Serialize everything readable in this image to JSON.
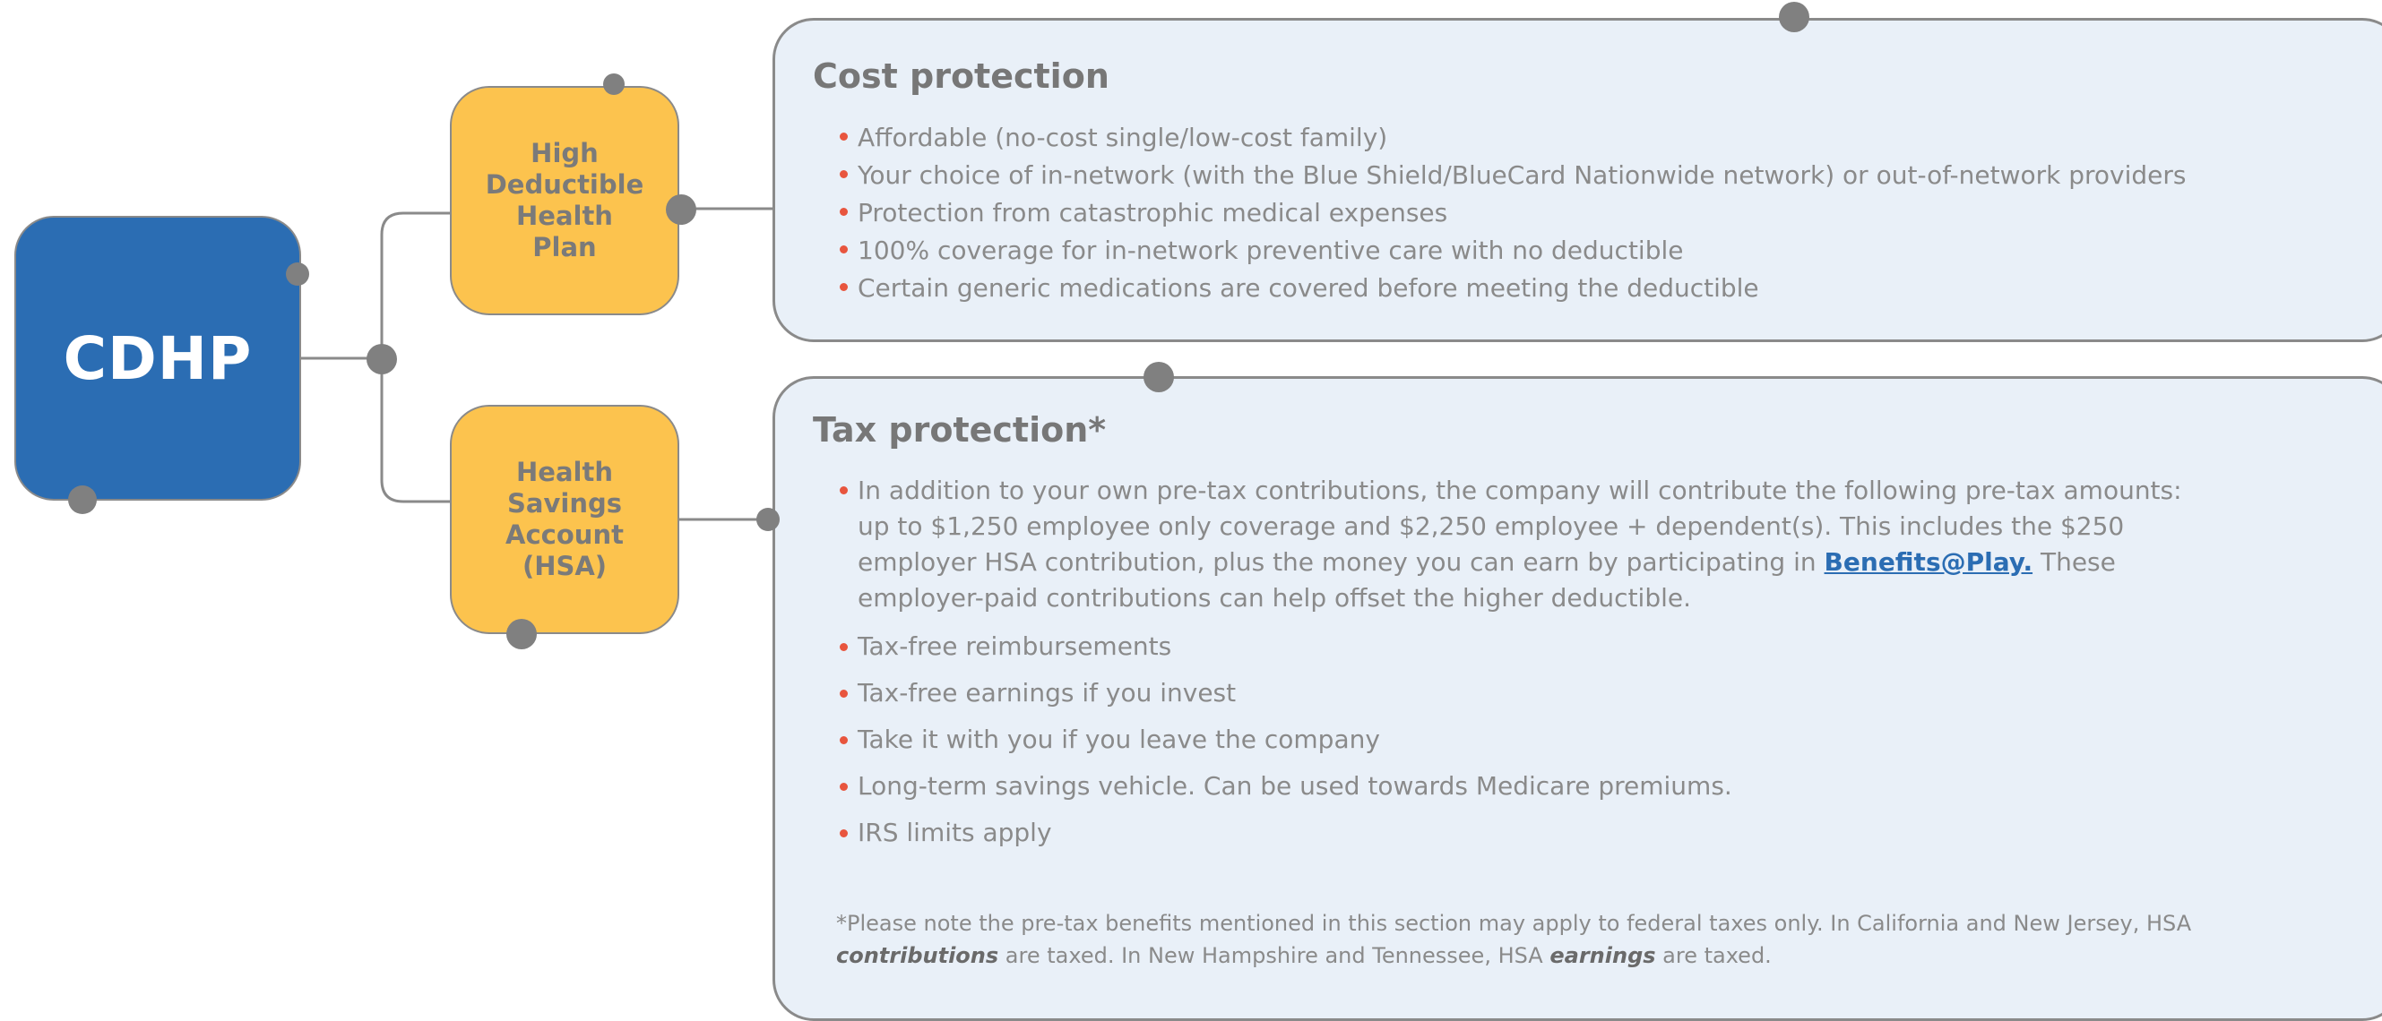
{
  "colors": {
    "cdhp_fill": "#2b6db3",
    "node_fill": "#fcc34e",
    "panel_fill": "#e9f0f8",
    "border": "#8a8a8a",
    "bullet": "#e8553e",
    "link": "#2b6db3"
  },
  "root": {
    "label": "CDHP"
  },
  "nodes": {
    "hdhp": {
      "lines": [
        "High",
        "Deductible",
        "Health",
        "Plan"
      ]
    },
    "hsa": {
      "lines": [
        "Health",
        "Savings",
        "Account (HSA)"
      ]
    }
  },
  "cost_panel": {
    "title": "Cost protection",
    "bullets": [
      "Affordable (no-cost single/low-cost family)",
      "Your choice of in-network (with the Blue Shield/BlueCard Nationwide network) or out-of-network providers",
      "Protection from catastrophic medical expenses",
      "100% coverage for in-network preventive care with no deductible",
      "Certain generic medications are covered before meeting the deductible"
    ]
  },
  "tax_panel": {
    "title": "Tax protection*",
    "first_bullet": {
      "before_link": "In addition to your own pre-tax contributions, the company will contribute the following pre-tax amounts: up to $1,250 employee only coverage and $2,250 employee + dependent(s). This includes the $250 employer HSA contribution, plus the money you can earn by participating in ",
      "link_text": "Benefits@Play.",
      "after_link": " These employer-paid contributions can help offset the higher deductible."
    },
    "bullets": [
      "Tax-free reimbursements",
      "Tax-free earnings if you invest",
      "Take it with you if you leave the company",
      "Long-term savings vehicle. Can be used towards Medicare premiums.",
      "IRS limits apply"
    ],
    "footnote": {
      "part1": "*Please note the pre-tax benefits mentioned in this section may apply to federal taxes only. In California and New Jersey, HSA ",
      "em1": "contributions",
      "part2": " are taxed. In New Hampshire and Tennessee, HSA ",
      "em2": "earnings",
      "part3": " are taxed."
    }
  }
}
